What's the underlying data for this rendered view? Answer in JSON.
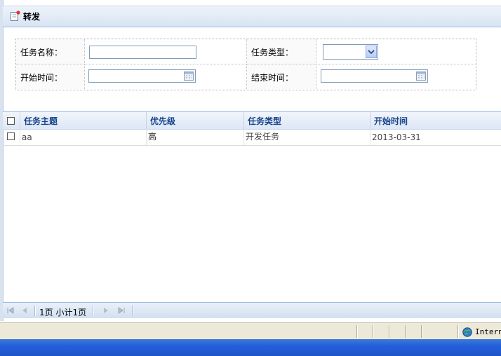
{
  "panel": {
    "title": "转发"
  },
  "form": {
    "task_name_label": "任务名称：",
    "task_name_value": "",
    "task_type_label": "任务类型：",
    "task_type_selected": "",
    "start_time_label": "开始时间：",
    "start_time_value": "",
    "end_time_label": "结束时间：",
    "end_time_value": ""
  },
  "grid": {
    "columns": [
      "任务主题",
      "优先级",
      "任务类型",
      "开始时间"
    ],
    "rows": [
      {
        "subject": "aa",
        "priority": "高",
        "type": "开发任务",
        "start": "2013-03-31"
      }
    ]
  },
  "pager": {
    "text": "1页 小计1页"
  },
  "statusbar": {
    "zone": "Internet"
  },
  "icons": [
    "panel-edit-icon",
    "calendar-icon",
    "first-page-icon",
    "prev-page-icon",
    "next-page-icon",
    "last-page-icon",
    "globe-icon"
  ]
}
